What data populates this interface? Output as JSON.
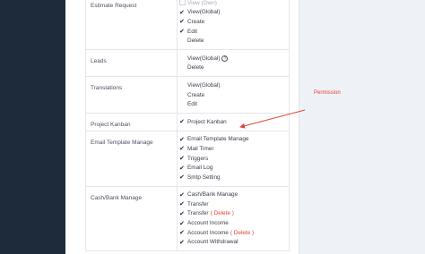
{
  "annotation": {
    "label": "Permission",
    "color": "#e0443a"
  },
  "groups": [
    {
      "label": "Estimate Request",
      "perms": [
        {
          "label": "View (Own)",
          "checked": false,
          "disabled": true
        },
        {
          "label": "View(Global)",
          "checked": true
        },
        {
          "label": "Create",
          "checked": true
        },
        {
          "label": "Edit",
          "checked": true
        },
        {
          "label": "Delete",
          "checked": false
        }
      ]
    },
    {
      "label": "Leads",
      "perms": [
        {
          "label": "View(Global)",
          "checked": false,
          "help": true
        },
        {
          "label": "Delete",
          "checked": false
        }
      ]
    },
    {
      "label": "Translations",
      "perms": [
        {
          "label": "View(Global)",
          "checked": false
        },
        {
          "label": "Create",
          "checked": false
        },
        {
          "label": "Edit",
          "checked": false
        }
      ]
    },
    {
      "label": "Project Kanban",
      "perms": [
        {
          "label": "Project Kanban",
          "checked": true
        }
      ]
    },
    {
      "label": "Email Template Manage",
      "perms": [
        {
          "label": "Email Template Manage",
          "checked": true
        },
        {
          "label": "Mail Timer",
          "checked": true
        },
        {
          "label": "Triggers",
          "checked": true
        },
        {
          "label": "Email Log",
          "checked": true
        },
        {
          "label": "Smtp Setting",
          "checked": true
        }
      ]
    },
    {
      "label": "Cash/Bank Manage",
      "perms": [
        {
          "label": "Cash/Bank Manage",
          "checked": true
        },
        {
          "label": "Transfer",
          "checked": true
        },
        {
          "label": "Transfer",
          "suffix": "( Delete )",
          "checked": true
        },
        {
          "label": "Account Income",
          "checked": true
        },
        {
          "label": "Account Income",
          "suffix": "( Delete )",
          "checked": true
        },
        {
          "label": "Account Withdrawal",
          "checked": true
        }
      ]
    }
  ]
}
